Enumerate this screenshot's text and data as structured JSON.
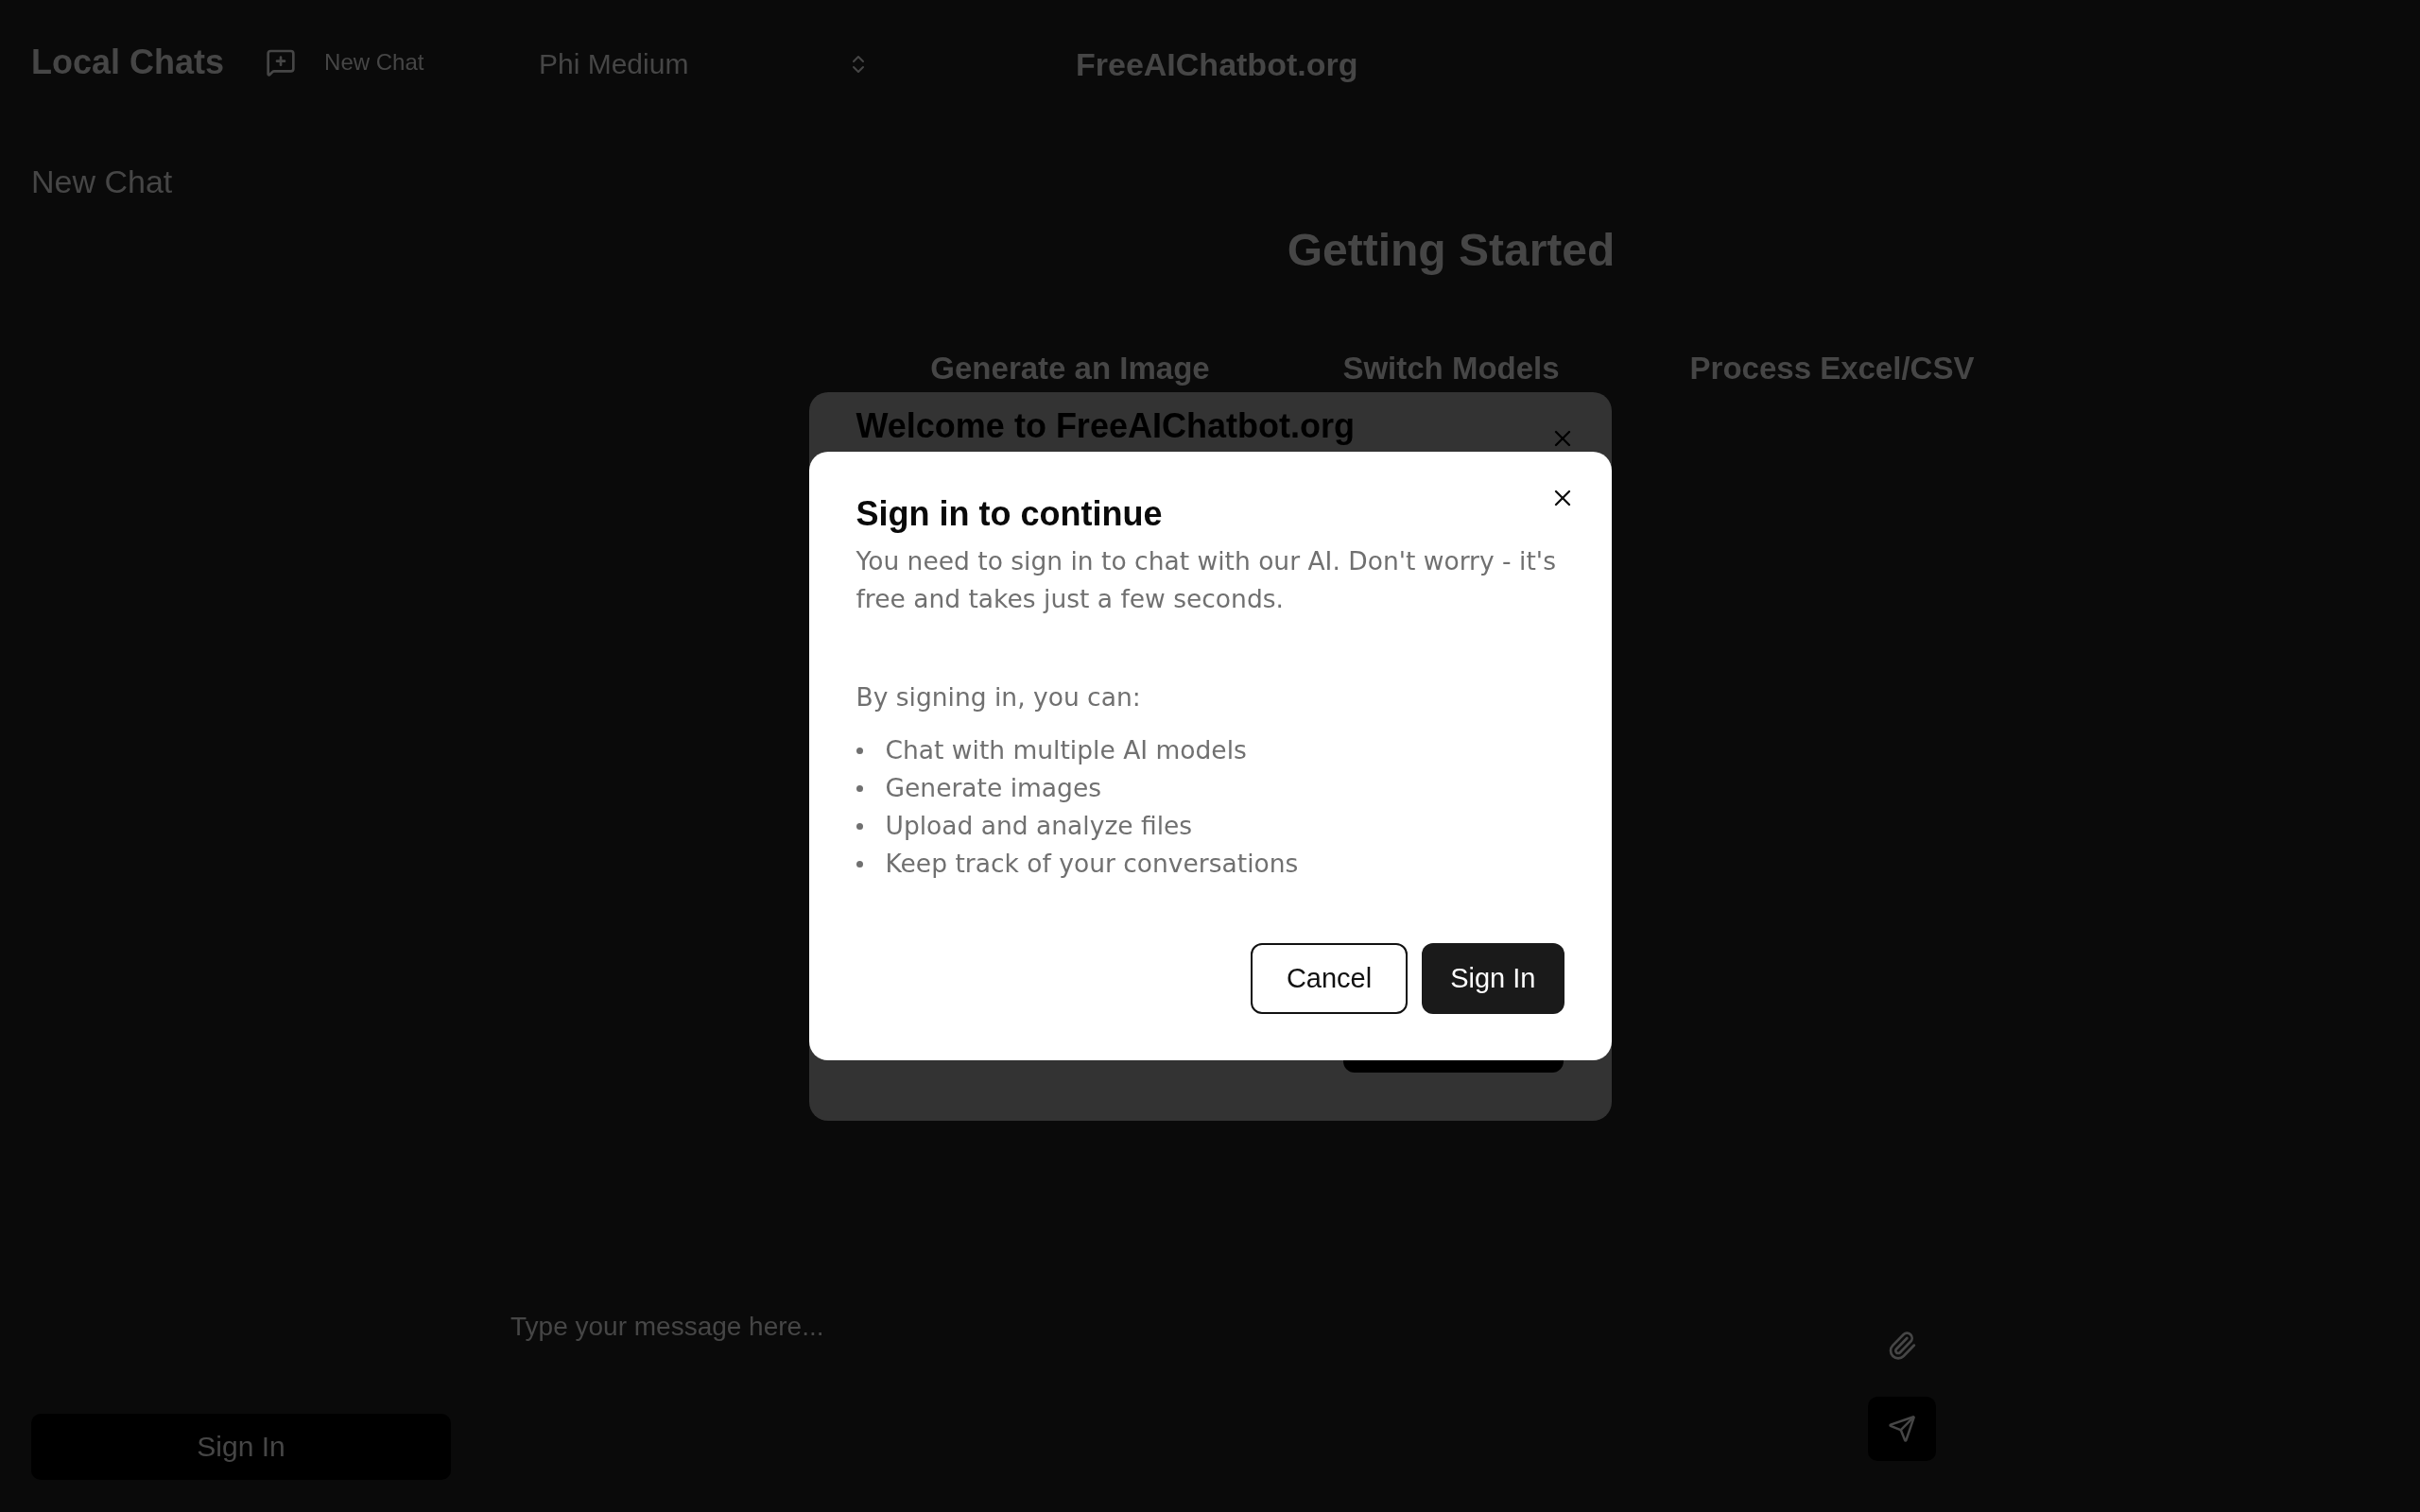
{
  "sidebar": {
    "title": "Local Chats",
    "new_chat_button": "New Chat",
    "chats": [
      {
        "title": "New Chat"
      }
    ],
    "sign_in_button": "Sign In"
  },
  "header": {
    "model_select": {
      "value": "Phi Medium"
    },
    "title": "FreeAIChatbot.org"
  },
  "main": {
    "heading": "Getting Started",
    "cards": [
      {
        "title": "Generate an Image"
      },
      {
        "title": "Switch Models"
      },
      {
        "title": "Process Excel/CSV"
      }
    ]
  },
  "composer": {
    "placeholder": "Type your message here..."
  },
  "background_dialog": {
    "title": "Welcome to FreeAIChatbot.org"
  },
  "dialog": {
    "title": "Sign in to continue",
    "description": "You need to sign in to chat with our AI. Don't worry - it's free and takes just a few seconds.",
    "list_intro": "By signing in, you can:",
    "benefits": [
      "Chat with multiple AI models",
      "Generate images",
      "Upload and analyze files",
      "Keep track of your conversations"
    ],
    "buttons": [
      {
        "label": "Cancel",
        "kind": "secondary"
      },
      {
        "label": "Sign In",
        "kind": "primary"
      }
    ]
  }
}
